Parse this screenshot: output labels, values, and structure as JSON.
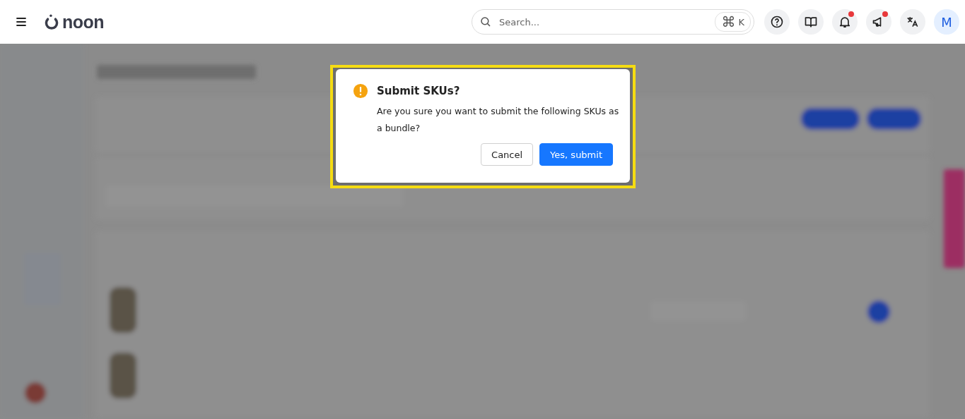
{
  "header": {
    "logo": "noon",
    "search": {
      "placeholder": "Search...",
      "shortcut_symbol": "⌘",
      "shortcut_key": "K"
    },
    "icon_buttons": [
      {
        "kind": "help",
        "has_dot": false
      },
      {
        "kind": "book",
        "has_dot": false
      },
      {
        "kind": "bell",
        "has_dot": true
      },
      {
        "kind": "megaphone",
        "has_dot": true
      },
      {
        "kind": "translate",
        "has_dot": false
      }
    ],
    "avatar": "M"
  },
  "dialog": {
    "title": "Submit SKUs?",
    "message": "Are you sure you want to submit the following SKUs as a bundle?",
    "buttons": [
      {
        "label": "Cancel",
        "kind": "secondary"
      },
      {
        "label": "Yes, submit",
        "kind": "primary"
      }
    ]
  }
}
